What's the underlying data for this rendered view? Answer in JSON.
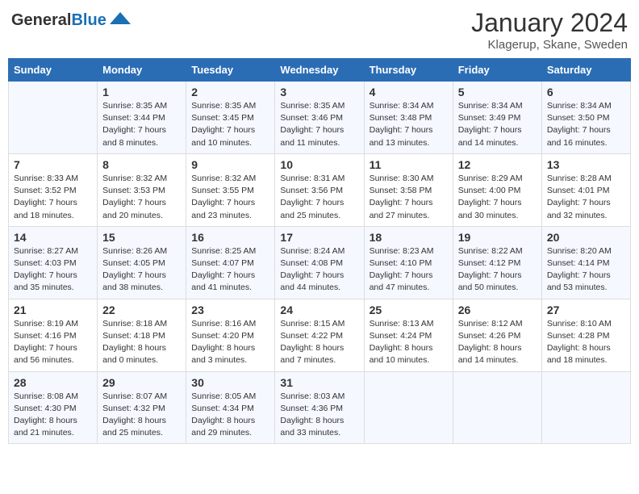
{
  "logo": {
    "general": "General",
    "blue": "Blue"
  },
  "header": {
    "title": "January 2024",
    "location": "Klagerup, Skane, Sweden"
  },
  "weekdays": [
    "Sunday",
    "Monday",
    "Tuesday",
    "Wednesday",
    "Thursday",
    "Friday",
    "Saturday"
  ],
  "weeks": [
    [
      {
        "day": "",
        "info": ""
      },
      {
        "day": "1",
        "info": "Sunrise: 8:35 AM\nSunset: 3:44 PM\nDaylight: 7 hours\nand 8 minutes."
      },
      {
        "day": "2",
        "info": "Sunrise: 8:35 AM\nSunset: 3:45 PM\nDaylight: 7 hours\nand 10 minutes."
      },
      {
        "day": "3",
        "info": "Sunrise: 8:35 AM\nSunset: 3:46 PM\nDaylight: 7 hours\nand 11 minutes."
      },
      {
        "day": "4",
        "info": "Sunrise: 8:34 AM\nSunset: 3:48 PM\nDaylight: 7 hours\nand 13 minutes."
      },
      {
        "day": "5",
        "info": "Sunrise: 8:34 AM\nSunset: 3:49 PM\nDaylight: 7 hours\nand 14 minutes."
      },
      {
        "day": "6",
        "info": "Sunrise: 8:34 AM\nSunset: 3:50 PM\nDaylight: 7 hours\nand 16 minutes."
      }
    ],
    [
      {
        "day": "7",
        "info": "Sunrise: 8:33 AM\nSunset: 3:52 PM\nDaylight: 7 hours\nand 18 minutes."
      },
      {
        "day": "8",
        "info": "Sunrise: 8:32 AM\nSunset: 3:53 PM\nDaylight: 7 hours\nand 20 minutes."
      },
      {
        "day": "9",
        "info": "Sunrise: 8:32 AM\nSunset: 3:55 PM\nDaylight: 7 hours\nand 23 minutes."
      },
      {
        "day": "10",
        "info": "Sunrise: 8:31 AM\nSunset: 3:56 PM\nDaylight: 7 hours\nand 25 minutes."
      },
      {
        "day": "11",
        "info": "Sunrise: 8:30 AM\nSunset: 3:58 PM\nDaylight: 7 hours\nand 27 minutes."
      },
      {
        "day": "12",
        "info": "Sunrise: 8:29 AM\nSunset: 4:00 PM\nDaylight: 7 hours\nand 30 minutes."
      },
      {
        "day": "13",
        "info": "Sunrise: 8:28 AM\nSunset: 4:01 PM\nDaylight: 7 hours\nand 32 minutes."
      }
    ],
    [
      {
        "day": "14",
        "info": "Sunrise: 8:27 AM\nSunset: 4:03 PM\nDaylight: 7 hours\nand 35 minutes."
      },
      {
        "day": "15",
        "info": "Sunrise: 8:26 AM\nSunset: 4:05 PM\nDaylight: 7 hours\nand 38 minutes."
      },
      {
        "day": "16",
        "info": "Sunrise: 8:25 AM\nSunset: 4:07 PM\nDaylight: 7 hours\nand 41 minutes."
      },
      {
        "day": "17",
        "info": "Sunrise: 8:24 AM\nSunset: 4:08 PM\nDaylight: 7 hours\nand 44 minutes."
      },
      {
        "day": "18",
        "info": "Sunrise: 8:23 AM\nSunset: 4:10 PM\nDaylight: 7 hours\nand 47 minutes."
      },
      {
        "day": "19",
        "info": "Sunrise: 8:22 AM\nSunset: 4:12 PM\nDaylight: 7 hours\nand 50 minutes."
      },
      {
        "day": "20",
        "info": "Sunrise: 8:20 AM\nSunset: 4:14 PM\nDaylight: 7 hours\nand 53 minutes."
      }
    ],
    [
      {
        "day": "21",
        "info": "Sunrise: 8:19 AM\nSunset: 4:16 PM\nDaylight: 7 hours\nand 56 minutes."
      },
      {
        "day": "22",
        "info": "Sunrise: 8:18 AM\nSunset: 4:18 PM\nDaylight: 8 hours\nand 0 minutes."
      },
      {
        "day": "23",
        "info": "Sunrise: 8:16 AM\nSunset: 4:20 PM\nDaylight: 8 hours\nand 3 minutes."
      },
      {
        "day": "24",
        "info": "Sunrise: 8:15 AM\nSunset: 4:22 PM\nDaylight: 8 hours\nand 7 minutes."
      },
      {
        "day": "25",
        "info": "Sunrise: 8:13 AM\nSunset: 4:24 PM\nDaylight: 8 hours\nand 10 minutes."
      },
      {
        "day": "26",
        "info": "Sunrise: 8:12 AM\nSunset: 4:26 PM\nDaylight: 8 hours\nand 14 minutes."
      },
      {
        "day": "27",
        "info": "Sunrise: 8:10 AM\nSunset: 4:28 PM\nDaylight: 8 hours\nand 18 minutes."
      }
    ],
    [
      {
        "day": "28",
        "info": "Sunrise: 8:08 AM\nSunset: 4:30 PM\nDaylight: 8 hours\nand 21 minutes."
      },
      {
        "day": "29",
        "info": "Sunrise: 8:07 AM\nSunset: 4:32 PM\nDaylight: 8 hours\nand 25 minutes."
      },
      {
        "day": "30",
        "info": "Sunrise: 8:05 AM\nSunset: 4:34 PM\nDaylight: 8 hours\nand 29 minutes."
      },
      {
        "day": "31",
        "info": "Sunrise: 8:03 AM\nSunset: 4:36 PM\nDaylight: 8 hours\nand 33 minutes."
      },
      {
        "day": "",
        "info": ""
      },
      {
        "day": "",
        "info": ""
      },
      {
        "day": "",
        "info": ""
      }
    ]
  ]
}
